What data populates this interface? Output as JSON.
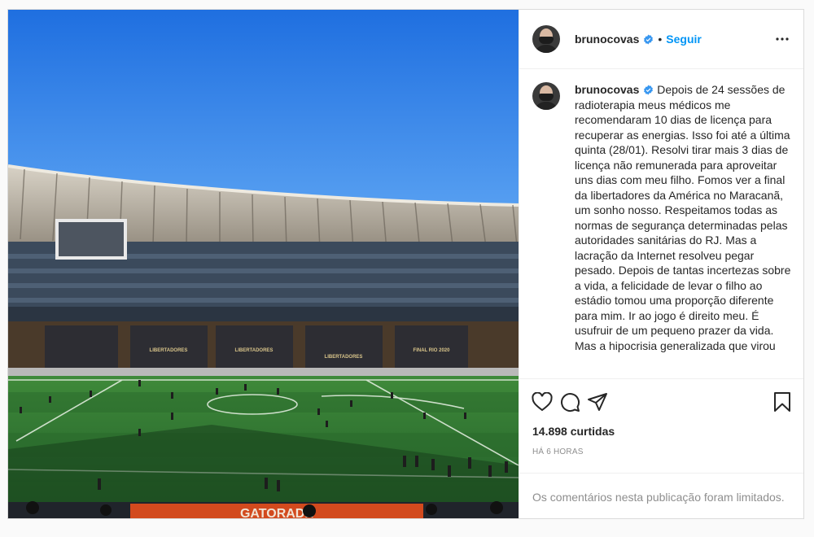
{
  "post": {
    "username": "brunocovas",
    "follow_label": "Seguir",
    "separator": "•",
    "caption": "Depois de 24 sessões de radioterapia meus médicos me recomendaram 10 dias de licença para recuperar as energias. Isso foi até a última quinta (28/01). Resolvi tirar mais 3 dias de licença não remunerada para aproveitar uns dias com meu filho. Fomos ver a final da libertadores da América no Maracanã, um sonho nosso. Respeitamos todas as normas de segurança determinadas pelas autoridades sanitárias do RJ. Mas a lacração da Internet resolveu pegar pesado. Depois de tantas incertezas sobre a vida, a felicidade de levar o filho ao estádio tomou uma proporção diferente para mim. Ir ao jogo é direito meu. É usufruir de um pequeno prazer da vida. Mas a hipocrisia generalizada que virou",
    "likes": "14.898 curtidas",
    "time": "HÁ 6 HORAS",
    "comments_limited": "Os comentários nesta publicação foram limitados."
  },
  "photo": {
    "board_labels": [
      "LIBERTADORES",
      "LIBERTADORES",
      "LIBERTADORES",
      "FINAL RIO 2020"
    ],
    "ad_text": "GATORADE"
  },
  "icons": {
    "verified": "verified-badge-icon",
    "more": "more-options-icon",
    "like": "heart-icon",
    "comment": "comment-icon",
    "share": "share-icon",
    "save": "bookmark-icon"
  },
  "colors": {
    "link": "#0095f6",
    "verified": "#3897f0",
    "muted": "#8e8e8e",
    "sky": "#2f7fe6",
    "pitch": "#2f7a33"
  }
}
